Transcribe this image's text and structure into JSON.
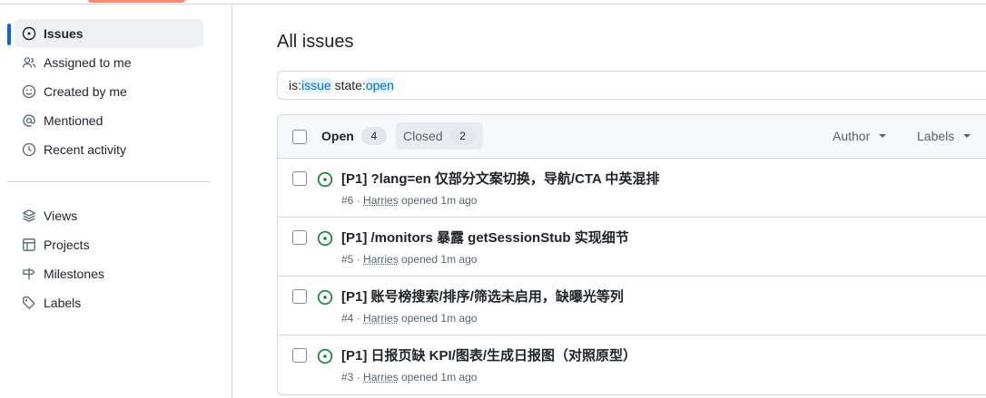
{
  "sidebar": {
    "items": [
      {
        "label": "Issues",
        "icon": "issue-opened-icon",
        "selected": true
      },
      {
        "label": "Assigned to me",
        "icon": "people-icon"
      },
      {
        "label": "Created by me",
        "icon": "smiley-icon"
      },
      {
        "label": "Mentioned",
        "icon": "mention-icon"
      },
      {
        "label": "Recent activity",
        "icon": "clock-icon"
      }
    ],
    "secondary": [
      {
        "label": "Views",
        "icon": "stack-icon"
      },
      {
        "label": "Projects",
        "icon": "table-icon"
      },
      {
        "label": "Milestones",
        "icon": "milestone-icon"
      },
      {
        "label": "Labels",
        "icon": "tag-icon"
      }
    ]
  },
  "main": {
    "title": "All issues",
    "search": {
      "tokens": [
        {
          "key": "is:",
          "value": "issue"
        },
        {
          "key": "state:",
          "value": "open"
        }
      ]
    },
    "tabs": {
      "open_label": "Open",
      "open_count": "4",
      "closed_label": "Closed",
      "closed_count": "2"
    },
    "filters": {
      "author": "Author",
      "labels": "Labels"
    },
    "issues": [
      {
        "title": "[P1] ?lang=en 仅部分文案切换，导航/CTA 中英混排",
        "number": "#6",
        "author": "Harries",
        "opened": "opened 1m ago"
      },
      {
        "title": "[P1] /monitors 暴露 getSessionStub 实现细节",
        "number": "#5",
        "author": "Harries",
        "opened": "opened 1m ago"
      },
      {
        "title": "[P1] 账号榜搜索/排序/筛选未启用，缺曝光等列",
        "number": "#4",
        "author": "Harries",
        "opened": "opened 1m ago"
      },
      {
        "title": "[P1] 日报页缺 KPI/图表/生成日报图（对照原型）",
        "number": "#3",
        "author": "Harries",
        "opened": "opened 1m ago"
      }
    ]
  },
  "colors": {
    "accent": "#0969da",
    "open_green": "#1a7f37",
    "tab_underline": "#fd8c73"
  }
}
